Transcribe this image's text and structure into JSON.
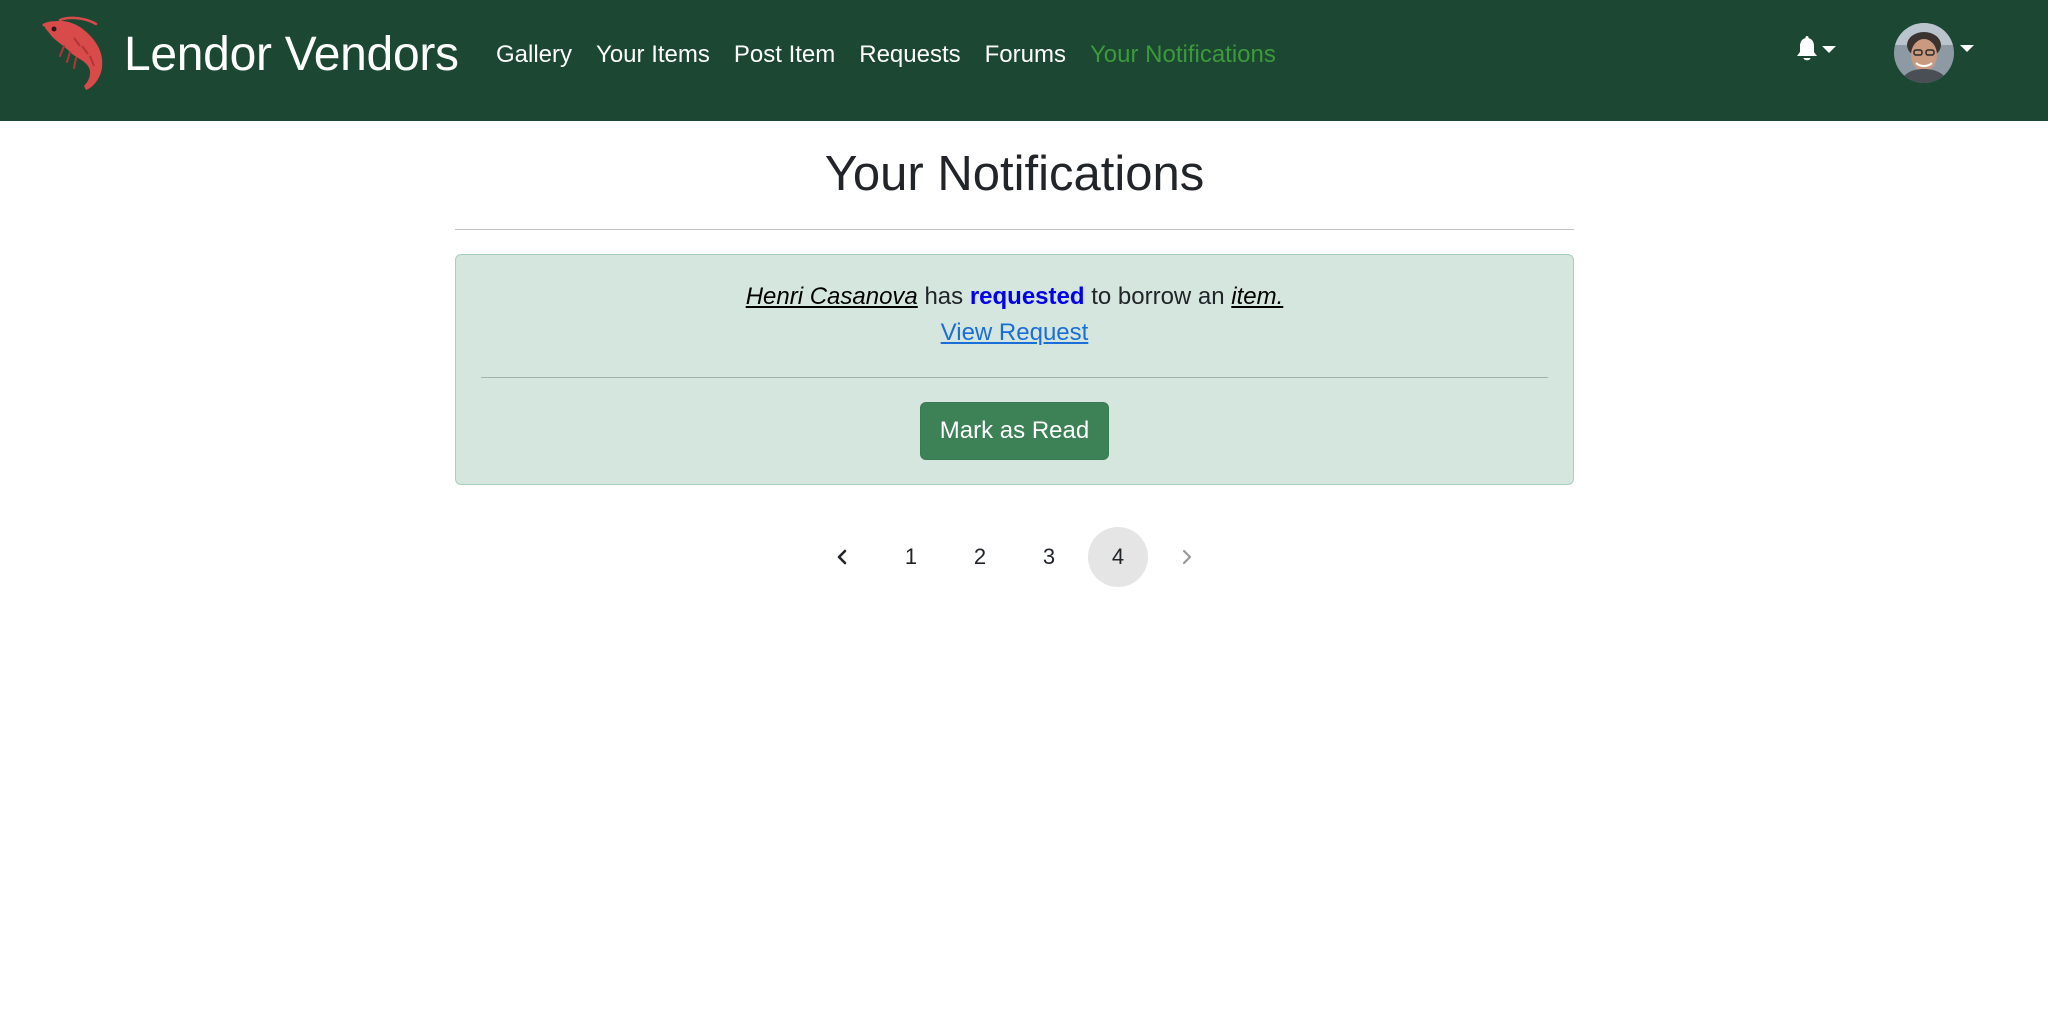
{
  "navbar": {
    "brand": "Lendor Vendors",
    "brand_icon": "shrimp-icon",
    "links": [
      {
        "label": "Gallery"
      },
      {
        "label": "Your Items"
      },
      {
        "label": "Post Item"
      },
      {
        "label": "Requests"
      },
      {
        "label": "Forums"
      },
      {
        "label": "Your Notifications",
        "active": true
      }
    ],
    "notifications_icon": "bell-icon",
    "user_menu_icon": "avatar"
  },
  "main": {
    "title": "Your Notifications",
    "notification": {
      "user": "Henri Casanova",
      "has": "has",
      "action": "requested",
      "middle": "to borrow an",
      "item": "item.",
      "link": "View Request",
      "button": "Mark as Read"
    }
  },
  "pagination": {
    "prev_icon": "chevron-left-icon",
    "next_icon": "chevron-right-icon",
    "pages": [
      "1",
      "2",
      "3",
      "4"
    ],
    "current": "4",
    "next_disabled": true
  },
  "colors": {
    "navbar_bg": "#1c4733",
    "active_link": "#3d9a3a",
    "card_bg": "#d5e6de",
    "button_bg": "#3d8157",
    "action_text": "#0000ee",
    "link_text": "#1a6ed8"
  }
}
